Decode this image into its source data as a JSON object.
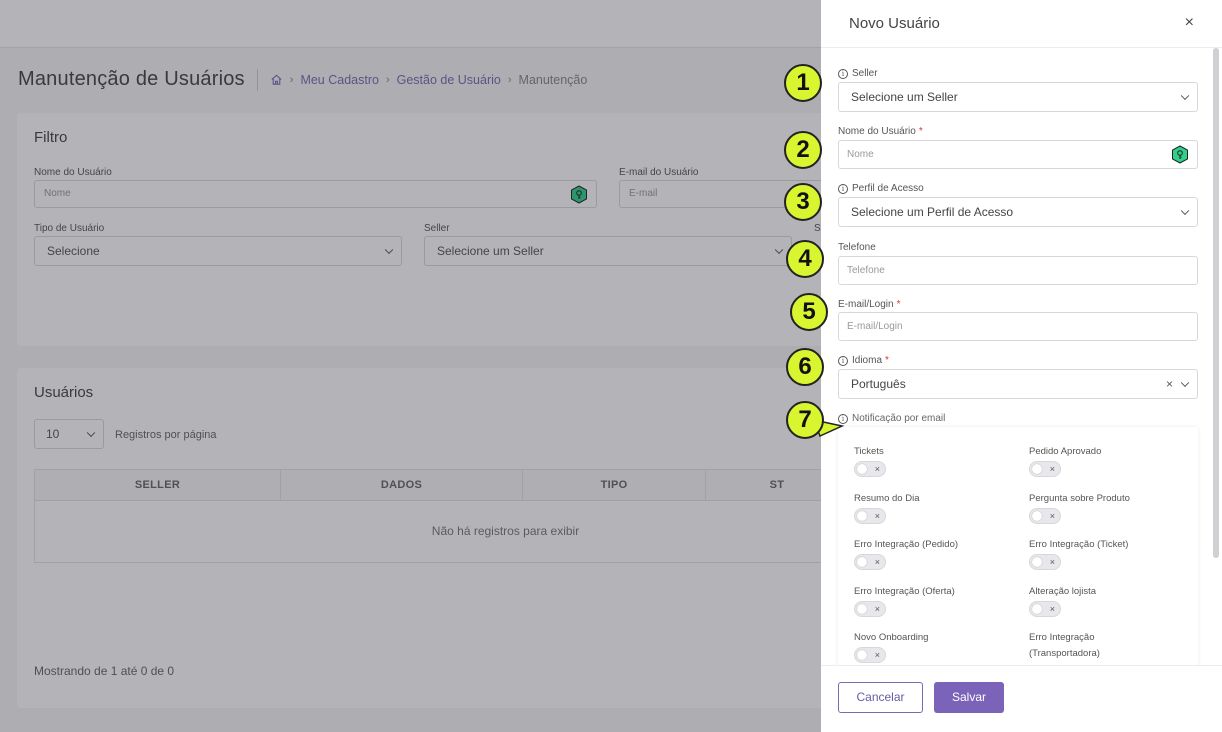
{
  "page": {
    "title": "Manutenção de Usuários",
    "breadcrumb": [
      "Meu Cadastro",
      "Gestão de Usuário",
      "Manutenção"
    ]
  },
  "filter": {
    "title": "Filtro",
    "name_label": "Nome do Usuário",
    "name_placeholder": "Nome",
    "email_label": "E-mail do Usuário",
    "email_placeholder": "E-mail",
    "type_label": "Tipo de Usuário",
    "type_value": "Selecione",
    "seller_label": "Seller",
    "seller_value": "Selecione um Seller",
    "status_label_partial": "St"
  },
  "users": {
    "title": "Usuários",
    "per_page": "10",
    "per_page_label": "Registros por página",
    "columns": [
      "SELLER",
      "DADOS",
      "TIPO",
      "ST"
    ],
    "empty": "Não há registros para exibir",
    "showing": "Mostrando de 1 até 0 de 0"
  },
  "drawer": {
    "title": "Novo Usuário",
    "close": "×",
    "seller_label": "Seller",
    "seller_value": "Selecione um Seller",
    "name_label": "Nome do Usuário",
    "name_placeholder": "Nome",
    "profile_label": "Perfil de Acesso",
    "profile_value": "Selecione um Perfil de Acesso",
    "phone_label": "Telefone",
    "phone_placeholder": "Telefone",
    "email_label": "E-mail/Login",
    "email_placeholder": "E-mail/Login",
    "language_label": "Idioma",
    "language_value": "Português",
    "required_mark": "*",
    "notifications_label": "Notificação por email",
    "notifications": [
      {
        "label": "Tickets",
        "enabled": false
      },
      {
        "label": "Pedido Aprovado",
        "enabled": false
      },
      {
        "label": "Resumo do Dia",
        "enabled": false
      },
      {
        "label": "Pergunta sobre Produto",
        "enabled": false
      },
      {
        "label": "Erro Integração (Pedido)",
        "enabled": false
      },
      {
        "label": "Erro Integração (Ticket)",
        "enabled": false
      },
      {
        "label": "Erro Integração (Oferta)",
        "enabled": false
      },
      {
        "label": "Alteração lojista",
        "enabled": false
      },
      {
        "label": "Novo Onboarding",
        "enabled": false
      },
      {
        "label": "Erro Integração (Transportadora)",
        "enabled": false
      }
    ],
    "toggle_off_glyph": "×",
    "cancel": "Cancelar",
    "save": "Salvar"
  },
  "markers": [
    "1",
    "2",
    "3",
    "4",
    "5",
    "6",
    "7"
  ],
  "colors": {
    "accent": "#7a63b8",
    "marker": "#d8f530",
    "key_icon": "#2fd08a"
  }
}
